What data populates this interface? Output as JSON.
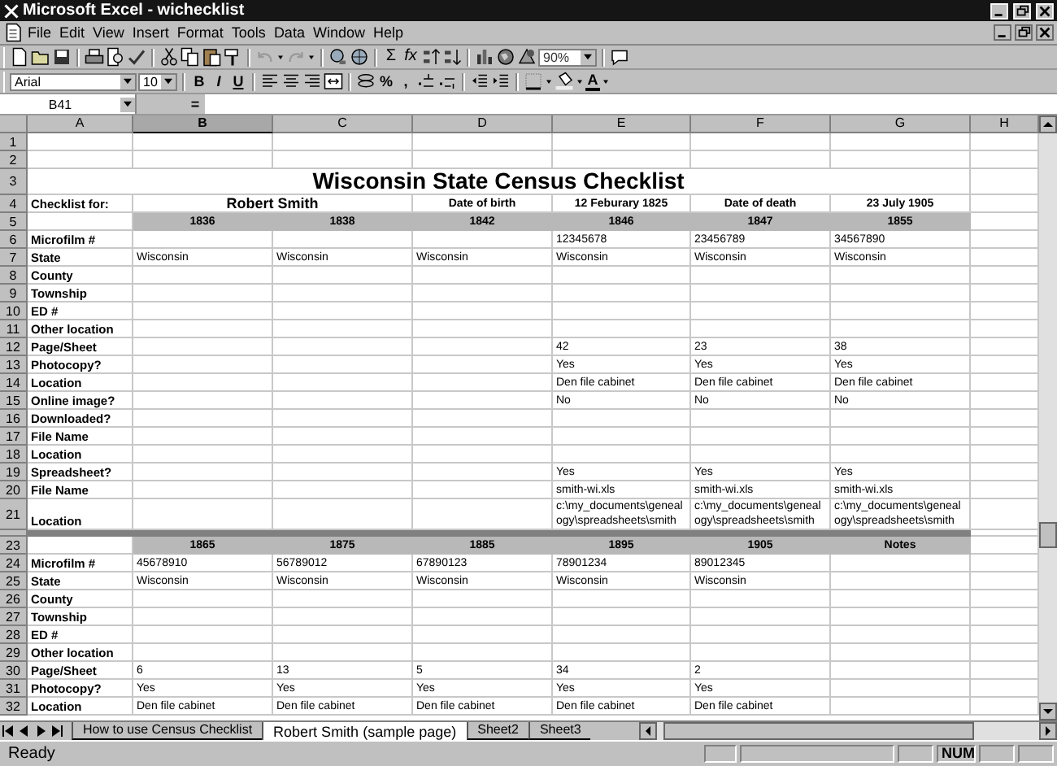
{
  "window": {
    "title": "Microsoft Excel - wichecklist"
  },
  "menu": [
    "File",
    "Edit",
    "View",
    "Insert",
    "Format",
    "Tools",
    "Data",
    "Window",
    "Help"
  ],
  "standard_toolbar": {
    "autosum": "Σ",
    "function": "fx",
    "zoom": "90%"
  },
  "format_toolbar": {
    "font": "Arial",
    "size": "10",
    "bold": "B",
    "italic": "I",
    "underline": "U",
    "percent": "%",
    "comma": ",",
    "font_color": "A"
  },
  "formula_bar": {
    "name_box": "B41",
    "equals": "="
  },
  "sheet": {
    "columns": [
      {
        "label": "A",
        "selected": false
      },
      {
        "label": "B",
        "selected": true
      },
      {
        "label": "C",
        "selected": false
      },
      {
        "label": "D",
        "selected": false
      },
      {
        "label": "E",
        "selected": false
      },
      {
        "label": "F",
        "selected": false
      },
      {
        "label": "G",
        "selected": false
      },
      {
        "label": "H",
        "selected": false
      }
    ],
    "rows": [
      {
        "number": "1",
        "kind": "data"
      },
      {
        "number": "2",
        "kind": "data"
      },
      {
        "number": "3",
        "kind": "title",
        "text": "Wisconsin State Census Checklist"
      },
      {
        "number": "4",
        "kind": "info",
        "cells": {
          "A": "Checklist for:",
          "B": "Robert Smith",
          "D": "Date of birth",
          "E": "12 Feburary 1825",
          "F": "Date of death",
          "G": "23 July 1905"
        }
      },
      {
        "number": "5",
        "kind": "band",
        "cells": {
          "B": "1836",
          "C": "1838",
          "D": "1842",
          "E": "1846",
          "F": "1847",
          "G": "1855"
        }
      },
      {
        "number": "6",
        "kind": "data",
        "cells": {
          "A": "Microfilm #",
          "E": "12345678",
          "F": "23456789",
          "G": "34567890"
        }
      },
      {
        "number": "7",
        "kind": "data",
        "cells": {
          "A": "State",
          "B": "Wisconsin",
          "C": "Wisconsin",
          "D": "Wisconsin",
          "E": "Wisconsin",
          "F": "Wisconsin",
          "G": "Wisconsin"
        }
      },
      {
        "number": "8",
        "kind": "data",
        "cells": {
          "A": "County"
        }
      },
      {
        "number": "9",
        "kind": "data",
        "cells": {
          "A": "Township"
        }
      },
      {
        "number": "10",
        "kind": "data",
        "cells": {
          "A": "ED #"
        }
      },
      {
        "number": "11",
        "kind": "data",
        "cells": {
          "A": "Other location"
        }
      },
      {
        "number": "12",
        "kind": "data",
        "cells": {
          "A": "Page/Sheet",
          "E": "42",
          "F": "23",
          "G": "38"
        }
      },
      {
        "number": "13",
        "kind": "data",
        "cells": {
          "A": "Photocopy?",
          "E": "Yes",
          "F": "Yes",
          "G": "Yes"
        }
      },
      {
        "number": "14",
        "kind": "data",
        "cells": {
          "A": "Location",
          "E": "Den file cabinet",
          "F": "Den file cabinet",
          "G": "Den file cabinet"
        }
      },
      {
        "number": "15",
        "kind": "data",
        "cells": {
          "A": "Online image?",
          "E": "No",
          "F": "No",
          "G": "No"
        }
      },
      {
        "number": "16",
        "kind": "data",
        "cells": {
          "A": "Downloaded?"
        }
      },
      {
        "number": "17",
        "kind": "data",
        "cells": {
          "A": "File Name"
        }
      },
      {
        "number": "18",
        "kind": "data",
        "cells": {
          "A": "Location"
        }
      },
      {
        "number": "19",
        "kind": "data",
        "cells": {
          "A": "Spreadsheet?",
          "E": "Yes",
          "F": "Yes",
          "G": "Yes"
        }
      },
      {
        "number": "20",
        "kind": "data",
        "cells": {
          "A": "File Name",
          "E": "smith-wi.xls",
          "F": "smith-wi.xls",
          "G": "smith-wi.xls"
        }
      },
      {
        "number": "21",
        "kind": "data",
        "cells": {
          "A": "Location",
          "E": "c:\\my_documents\\genealogy\\spreadsheets\\smith",
          "F": "c:\\my_documents\\genealogy\\spreadsheets\\smith",
          "G": "c:\\my_documents\\genealogy\\spreadsheets\\smith"
        }
      },
      {
        "kind": "divider"
      },
      {
        "number": "23",
        "kind": "band",
        "cells": {
          "B": "1865",
          "C": "1875",
          "D": "1885",
          "E": "1895",
          "F": "1905",
          "G": "Notes"
        }
      },
      {
        "number": "24",
        "kind": "data",
        "cells": {
          "A": "Microfilm #",
          "B": "45678910",
          "C": "56789012",
          "D": "67890123",
          "E": "78901234",
          "F": "89012345"
        }
      },
      {
        "number": "25",
        "kind": "data",
        "cells": {
          "A": "State",
          "B": "Wisconsin",
          "C": "Wisconsin",
          "D": "Wisconsin",
          "E": "Wisconsin",
          "F": "Wisconsin"
        }
      },
      {
        "number": "26",
        "kind": "data",
        "cells": {
          "A": "County"
        }
      },
      {
        "number": "27",
        "kind": "data",
        "cells": {
          "A": "Township"
        }
      },
      {
        "number": "28",
        "kind": "data",
        "cells": {
          "A": "ED #"
        }
      },
      {
        "number": "29",
        "kind": "data",
        "cells": {
          "A": "Other location"
        }
      },
      {
        "number": "30",
        "kind": "data",
        "cells": {
          "A": "Page/Sheet",
          "B": "6",
          "C": "13",
          "D": "5",
          "E": "34",
          "F": "2"
        }
      },
      {
        "number": "31",
        "kind": "data",
        "cells": {
          "A": "Photocopy?",
          "B": "Yes",
          "C": "Yes",
          "D": "Yes",
          "E": "Yes",
          "F": "Yes"
        }
      },
      {
        "number": "32",
        "kind": "data",
        "cells": {
          "A": "Location",
          "B": "Den file cabinet",
          "C": "Den file cabinet",
          "D": "Den file cabinet",
          "E": "Den file cabinet",
          "F": "Den file cabinet"
        }
      }
    ]
  },
  "sheet_tabs": [
    {
      "label": "How to use Census Checklist",
      "selected": false
    },
    {
      "label": "Robert Smith (sample page)",
      "selected": true
    },
    {
      "label": "Sheet2",
      "selected": false
    },
    {
      "label": "Sheet3",
      "selected": false
    }
  ],
  "status_bar": {
    "text": "Ready",
    "indicators": [
      "NUM"
    ]
  }
}
